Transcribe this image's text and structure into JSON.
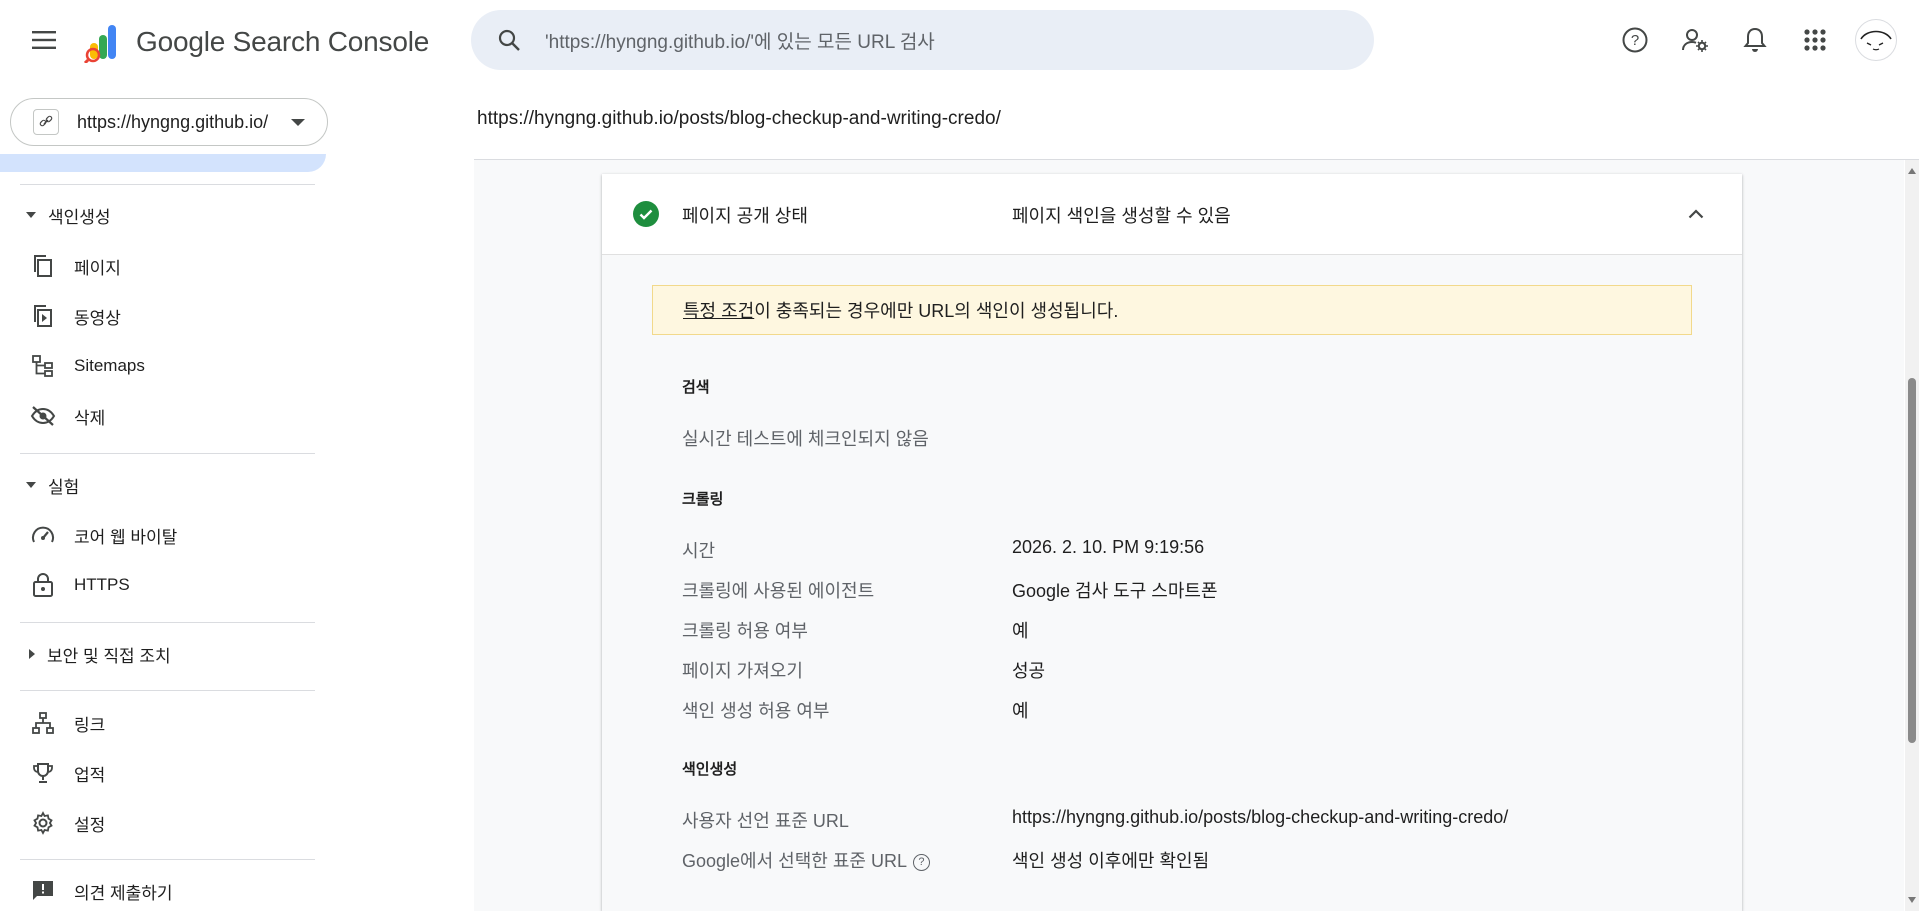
{
  "app": {
    "logo_text": "Google Search Console",
    "search_placeholder": "'https://hyngng.github.io/'에 있는 모든 URL 검사"
  },
  "property": {
    "label": "https://hyngng.github.io/",
    "icon_glyph": "🔗"
  },
  "sidebar": {
    "indexing_section": "색인생성",
    "indexing_items": [
      {
        "label": "페이지",
        "icon": "pages-icon"
      },
      {
        "label": "동영상",
        "icon": "video-pages-icon"
      },
      {
        "label": "Sitemaps",
        "icon": "sitemaps-icon"
      },
      {
        "label": "삭제",
        "icon": "removals-icon"
      }
    ],
    "experience_section": "실험",
    "experience_items": [
      {
        "label": "코어 웹 바이탈",
        "icon": "speed-gauge-icon"
      },
      {
        "label": "HTTPS",
        "icon": "lock-icon"
      }
    ],
    "security_section": "보안 및 직접 조치",
    "bottom_items": [
      {
        "label": "링크",
        "icon": "links-icon"
      },
      {
        "label": "업적",
        "icon": "trophy-icon"
      },
      {
        "label": "설정",
        "icon": "gear-icon"
      },
      {
        "label": "의견 제출하기",
        "icon": "feedback-icon"
      }
    ]
  },
  "inspected_url": "https://hyngng.github.io/posts/blog-checkup-and-writing-credo/",
  "card": {
    "title": "페이지 공개 상태",
    "status": "페이지 색인을 생성할 수 있음",
    "notice_link": "특정 조건",
    "notice_rest": "이 충족되는 경우에만 URL의 색인이 생성됩니다.",
    "search_heading": "검색",
    "search_text": "실시간 테스트에 체크인되지 않음",
    "crawl_heading": "크롤링",
    "crawl_rows": [
      {
        "label": "시간",
        "value": "2026. 2. 10. PM 9:19:56"
      },
      {
        "label": "크롤링에 사용된 에이전트",
        "value": "Google 검사 도구 스마트폰"
      },
      {
        "label": "크롤링 허용 여부",
        "value": "예"
      },
      {
        "label": "페이지 가져오기",
        "value": "성공"
      },
      {
        "label": "색인 생성 허용 여부",
        "value": "예"
      }
    ],
    "index_heading": "색인생성",
    "index_rows": [
      {
        "label": "사용자 선언 표준 URL",
        "value": "https://hyngng.github.io/posts/blog-checkup-and-writing-credo/"
      },
      {
        "label": "Google에서 선택한 표준 URL",
        "value": "색인 생성 이후에만 확인됨",
        "help": "?"
      }
    ]
  },
  "colors": {
    "search_bg": "#e9eef6",
    "success_green": "#1e8e3e",
    "notice_bg": "#fef7e0",
    "selected_nav": "#d3e3fd"
  }
}
